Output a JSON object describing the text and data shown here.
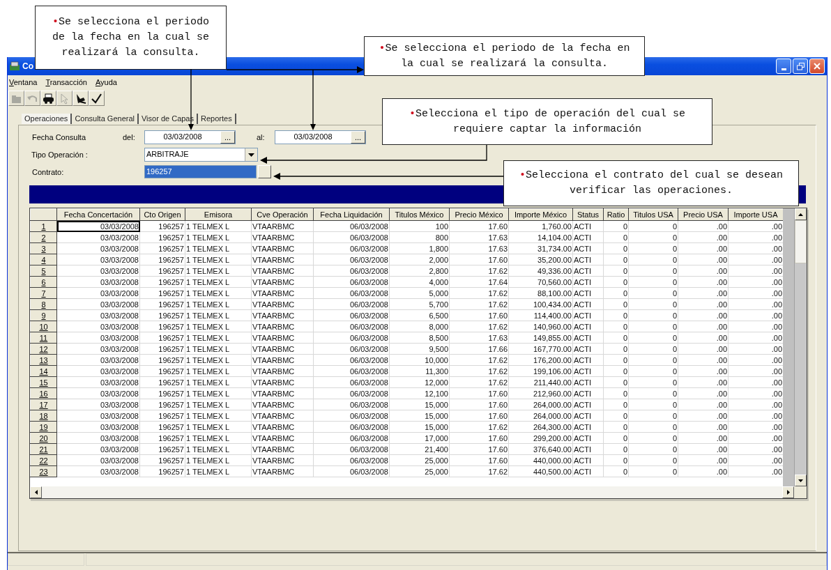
{
  "annotations": [
    {
      "bullet": "•",
      "text": "Se selecciona el periodo de la fecha en la cual se realizará la consulta."
    },
    {
      "bullet": "•",
      "text": "Se selecciona el periodo de la fecha en la cual se realizará la consulta."
    },
    {
      "bullet": "•",
      "text": "Selecciona el tipo de operación del cual se requiere captar la información"
    },
    {
      "bullet": "•",
      "text": "Selecciona el contrato del cual se desean verificar las operaciones."
    }
  ],
  "window": {
    "title": "Co"
  },
  "menu": [
    "Ventana",
    "Transacción",
    "Ayuda"
  ],
  "toolbar": [
    {
      "kind": "box",
      "disabled": true
    },
    {
      "kind": "undo",
      "disabled": true
    },
    {
      "kind": "print",
      "disabled": false
    },
    {
      "kind": "hand",
      "disabled": true
    },
    {
      "kind": "tool",
      "disabled": false
    },
    {
      "kind": "check",
      "disabled": false
    }
  ],
  "tabs": [
    {
      "label": "Operaciones",
      "selected": true
    },
    {
      "label": "Consulta General",
      "selected": false
    },
    {
      "label": "Visor de Capas",
      "selected": false
    },
    {
      "label": "Reportes",
      "selected": false
    }
  ],
  "form": {
    "fecha_label": "Fecha Consulta",
    "del_label": "del:",
    "del_field": {
      "value": "03/03/2008",
      "button": "..."
    },
    "al_label": "al:",
    "al_field": {
      "value": "03/03/2008",
      "button": "..."
    },
    "tipo_label": "Tipo Operación :",
    "tipo_value": "ARBITRAJE",
    "contrato_label": "Contrato:",
    "contrato_value": "196257",
    "contrato_selected": true
  },
  "table": {
    "columns": [
      "Fecha Concertación",
      "Cto Origen",
      "Emisora",
      "Cve Operación",
      "Fecha Liquidación",
      "Titulos México",
      "Precio México",
      "Importe México",
      "Status",
      "Ratio",
      "Titulos USA",
      "Precio USA",
      "Importe USA"
    ],
    "rows": [
      {
        "number": "1",
        "focused": true,
        "cells": [
          "03/03/2008",
          "196257",
          "1 TELMEX L",
          "VTAARBMC",
          "06/03/2008",
          "100",
          "17.60",
          "1,760.00",
          "ACTI",
          "0",
          "0",
          ".00",
          ".00"
        ]
      },
      {
        "number": "2",
        "focused": false,
        "cells": [
          "03/03/2008",
          "196257",
          "1 TELMEX L",
          "VTAARBMC",
          "06/03/2008",
          "800",
          "17.63",
          "14,104.00",
          "ACTI",
          "0",
          "0",
          ".00",
          ".00"
        ]
      },
      {
        "number": "3",
        "focused": false,
        "cells": [
          "03/03/2008",
          "196257",
          "1 TELMEX L",
          "VTAARBMC",
          "06/03/2008",
          "1,800",
          "17.63",
          "31,734.00",
          "ACTI",
          "0",
          "0",
          ".00",
          ".00"
        ]
      },
      {
        "number": "4",
        "focused": false,
        "cells": [
          "03/03/2008",
          "196257",
          "1 TELMEX L",
          "VTAARBMC",
          "06/03/2008",
          "2,000",
          "17.60",
          "35,200.00",
          "ACTI",
          "0",
          "0",
          ".00",
          ".00"
        ]
      },
      {
        "number": "5",
        "focused": false,
        "cells": [
          "03/03/2008",
          "196257",
          "1 TELMEX L",
          "VTAARBMC",
          "06/03/2008",
          "2,800",
          "17.62",
          "49,336.00",
          "ACTI",
          "0",
          "0",
          ".00",
          ".00"
        ]
      },
      {
        "number": "6",
        "focused": false,
        "cells": [
          "03/03/2008",
          "196257",
          "1 TELMEX L",
          "VTAARBMC",
          "06/03/2008",
          "4,000",
          "17.64",
          "70,560.00",
          "ACTI",
          "0",
          "0",
          ".00",
          ".00"
        ]
      },
      {
        "number": "7",
        "focused": false,
        "cells": [
          "03/03/2008",
          "196257",
          "1 TELMEX L",
          "VTAARBMC",
          "06/03/2008",
          "5,000",
          "17.62",
          "88,100.00",
          "ACTI",
          "0",
          "0",
          ".00",
          ".00"
        ]
      },
      {
        "number": "8",
        "focused": false,
        "cells": [
          "03/03/2008",
          "196257",
          "1 TELMEX L",
          "VTAARBMC",
          "06/03/2008",
          "5,700",
          "17.62",
          "100,434.00",
          "ACTI",
          "0",
          "0",
          ".00",
          ".00"
        ]
      },
      {
        "number": "9",
        "focused": false,
        "cells": [
          "03/03/2008",
          "196257",
          "1 TELMEX L",
          "VTAARBMC",
          "06/03/2008",
          "6,500",
          "17.60",
          "114,400.00",
          "ACTI",
          "0",
          "0",
          ".00",
          ".00"
        ]
      },
      {
        "number": "10",
        "focused": false,
        "cells": [
          "03/03/2008",
          "196257",
          "1 TELMEX L",
          "VTAARBMC",
          "06/03/2008",
          "8,000",
          "17.62",
          "140,960.00",
          "ACTI",
          "0",
          "0",
          ".00",
          ".00"
        ]
      },
      {
        "number": "11",
        "focused": false,
        "cells": [
          "03/03/2008",
          "196257",
          "1 TELMEX L",
          "VTAARBMC",
          "06/03/2008",
          "8,500",
          "17.63",
          "149,855.00",
          "ACTI",
          "0",
          "0",
          ".00",
          ".00"
        ]
      },
      {
        "number": "12",
        "focused": false,
        "cells": [
          "03/03/2008",
          "196257",
          "1 TELMEX L",
          "VTAARBMC",
          "06/03/2008",
          "9,500",
          "17.66",
          "167,770.00",
          "ACTI",
          "0",
          "0",
          ".00",
          ".00"
        ]
      },
      {
        "number": "13",
        "focused": false,
        "cells": [
          "03/03/2008",
          "196257",
          "1 TELMEX L",
          "VTAARBMC",
          "06/03/2008",
          "10,000",
          "17.62",
          "176,200.00",
          "ACTI",
          "0",
          "0",
          ".00",
          ".00"
        ]
      },
      {
        "number": "14",
        "focused": false,
        "cells": [
          "03/03/2008",
          "196257",
          "1 TELMEX L",
          "VTAARBMC",
          "06/03/2008",
          "11,300",
          "17.62",
          "199,106.00",
          "ACTI",
          "0",
          "0",
          ".00",
          ".00"
        ]
      },
      {
        "number": "15",
        "focused": false,
        "cells": [
          "03/03/2008",
          "196257",
          "1 TELMEX L",
          "VTAARBMC",
          "06/03/2008",
          "12,000",
          "17.62",
          "211,440.00",
          "ACTI",
          "0",
          "0",
          ".00",
          ".00"
        ]
      },
      {
        "number": "16",
        "focused": false,
        "cells": [
          "03/03/2008",
          "196257",
          "1 TELMEX L",
          "VTAARBMC",
          "06/03/2008",
          "12,100",
          "17.60",
          "212,960.00",
          "ACTI",
          "0",
          "0",
          ".00",
          ".00"
        ]
      },
      {
        "number": "17",
        "focused": false,
        "cells": [
          "03/03/2008",
          "196257",
          "1 TELMEX L",
          "VTAARBMC",
          "06/03/2008",
          "15,000",
          "17.60",
          "264,000.00",
          "ACTI",
          "0",
          "0",
          ".00",
          ".00"
        ]
      },
      {
        "number": "18",
        "focused": false,
        "cells": [
          "03/03/2008",
          "196257",
          "1 TELMEX L",
          "VTAARBMC",
          "06/03/2008",
          "15,000",
          "17.60",
          "264,000.00",
          "ACTI",
          "0",
          "0",
          ".00",
          ".00"
        ]
      },
      {
        "number": "19",
        "focused": false,
        "cells": [
          "03/03/2008",
          "196257",
          "1 TELMEX L",
          "VTAARBMC",
          "06/03/2008",
          "15,000",
          "17.62",
          "264,300.00",
          "ACTI",
          "0",
          "0",
          ".00",
          ".00"
        ]
      },
      {
        "number": "20",
        "focused": false,
        "cells": [
          "03/03/2008",
          "196257",
          "1 TELMEX L",
          "VTAARBMC",
          "06/03/2008",
          "17,000",
          "17.60",
          "299,200.00",
          "ACTI",
          "0",
          "0",
          ".00",
          ".00"
        ]
      },
      {
        "number": "21",
        "focused": false,
        "cells": [
          "03/03/2008",
          "196257",
          "1 TELMEX L",
          "VTAARBMC",
          "06/03/2008",
          "21,400",
          "17.60",
          "376,640.00",
          "ACTI",
          "0",
          "0",
          ".00",
          ".00"
        ]
      },
      {
        "number": "22",
        "focused": false,
        "cells": [
          "03/03/2008",
          "196257",
          "1 TELMEX L",
          "VTAARBMC",
          "06/03/2008",
          "25,000",
          "17.60",
          "440,000.00",
          "ACTI",
          "0",
          "0",
          ".00",
          ".00"
        ]
      },
      {
        "number": "23",
        "focused": false,
        "cells": [
          "03/03/2008",
          "196257",
          "1 TELMEX L",
          "VTAARBMC",
          "06/03/2008",
          "25,000",
          "17.62",
          "440,500.00",
          "ACTI",
          "0",
          "0",
          ".00",
          ".00"
        ]
      }
    ]
  }
}
